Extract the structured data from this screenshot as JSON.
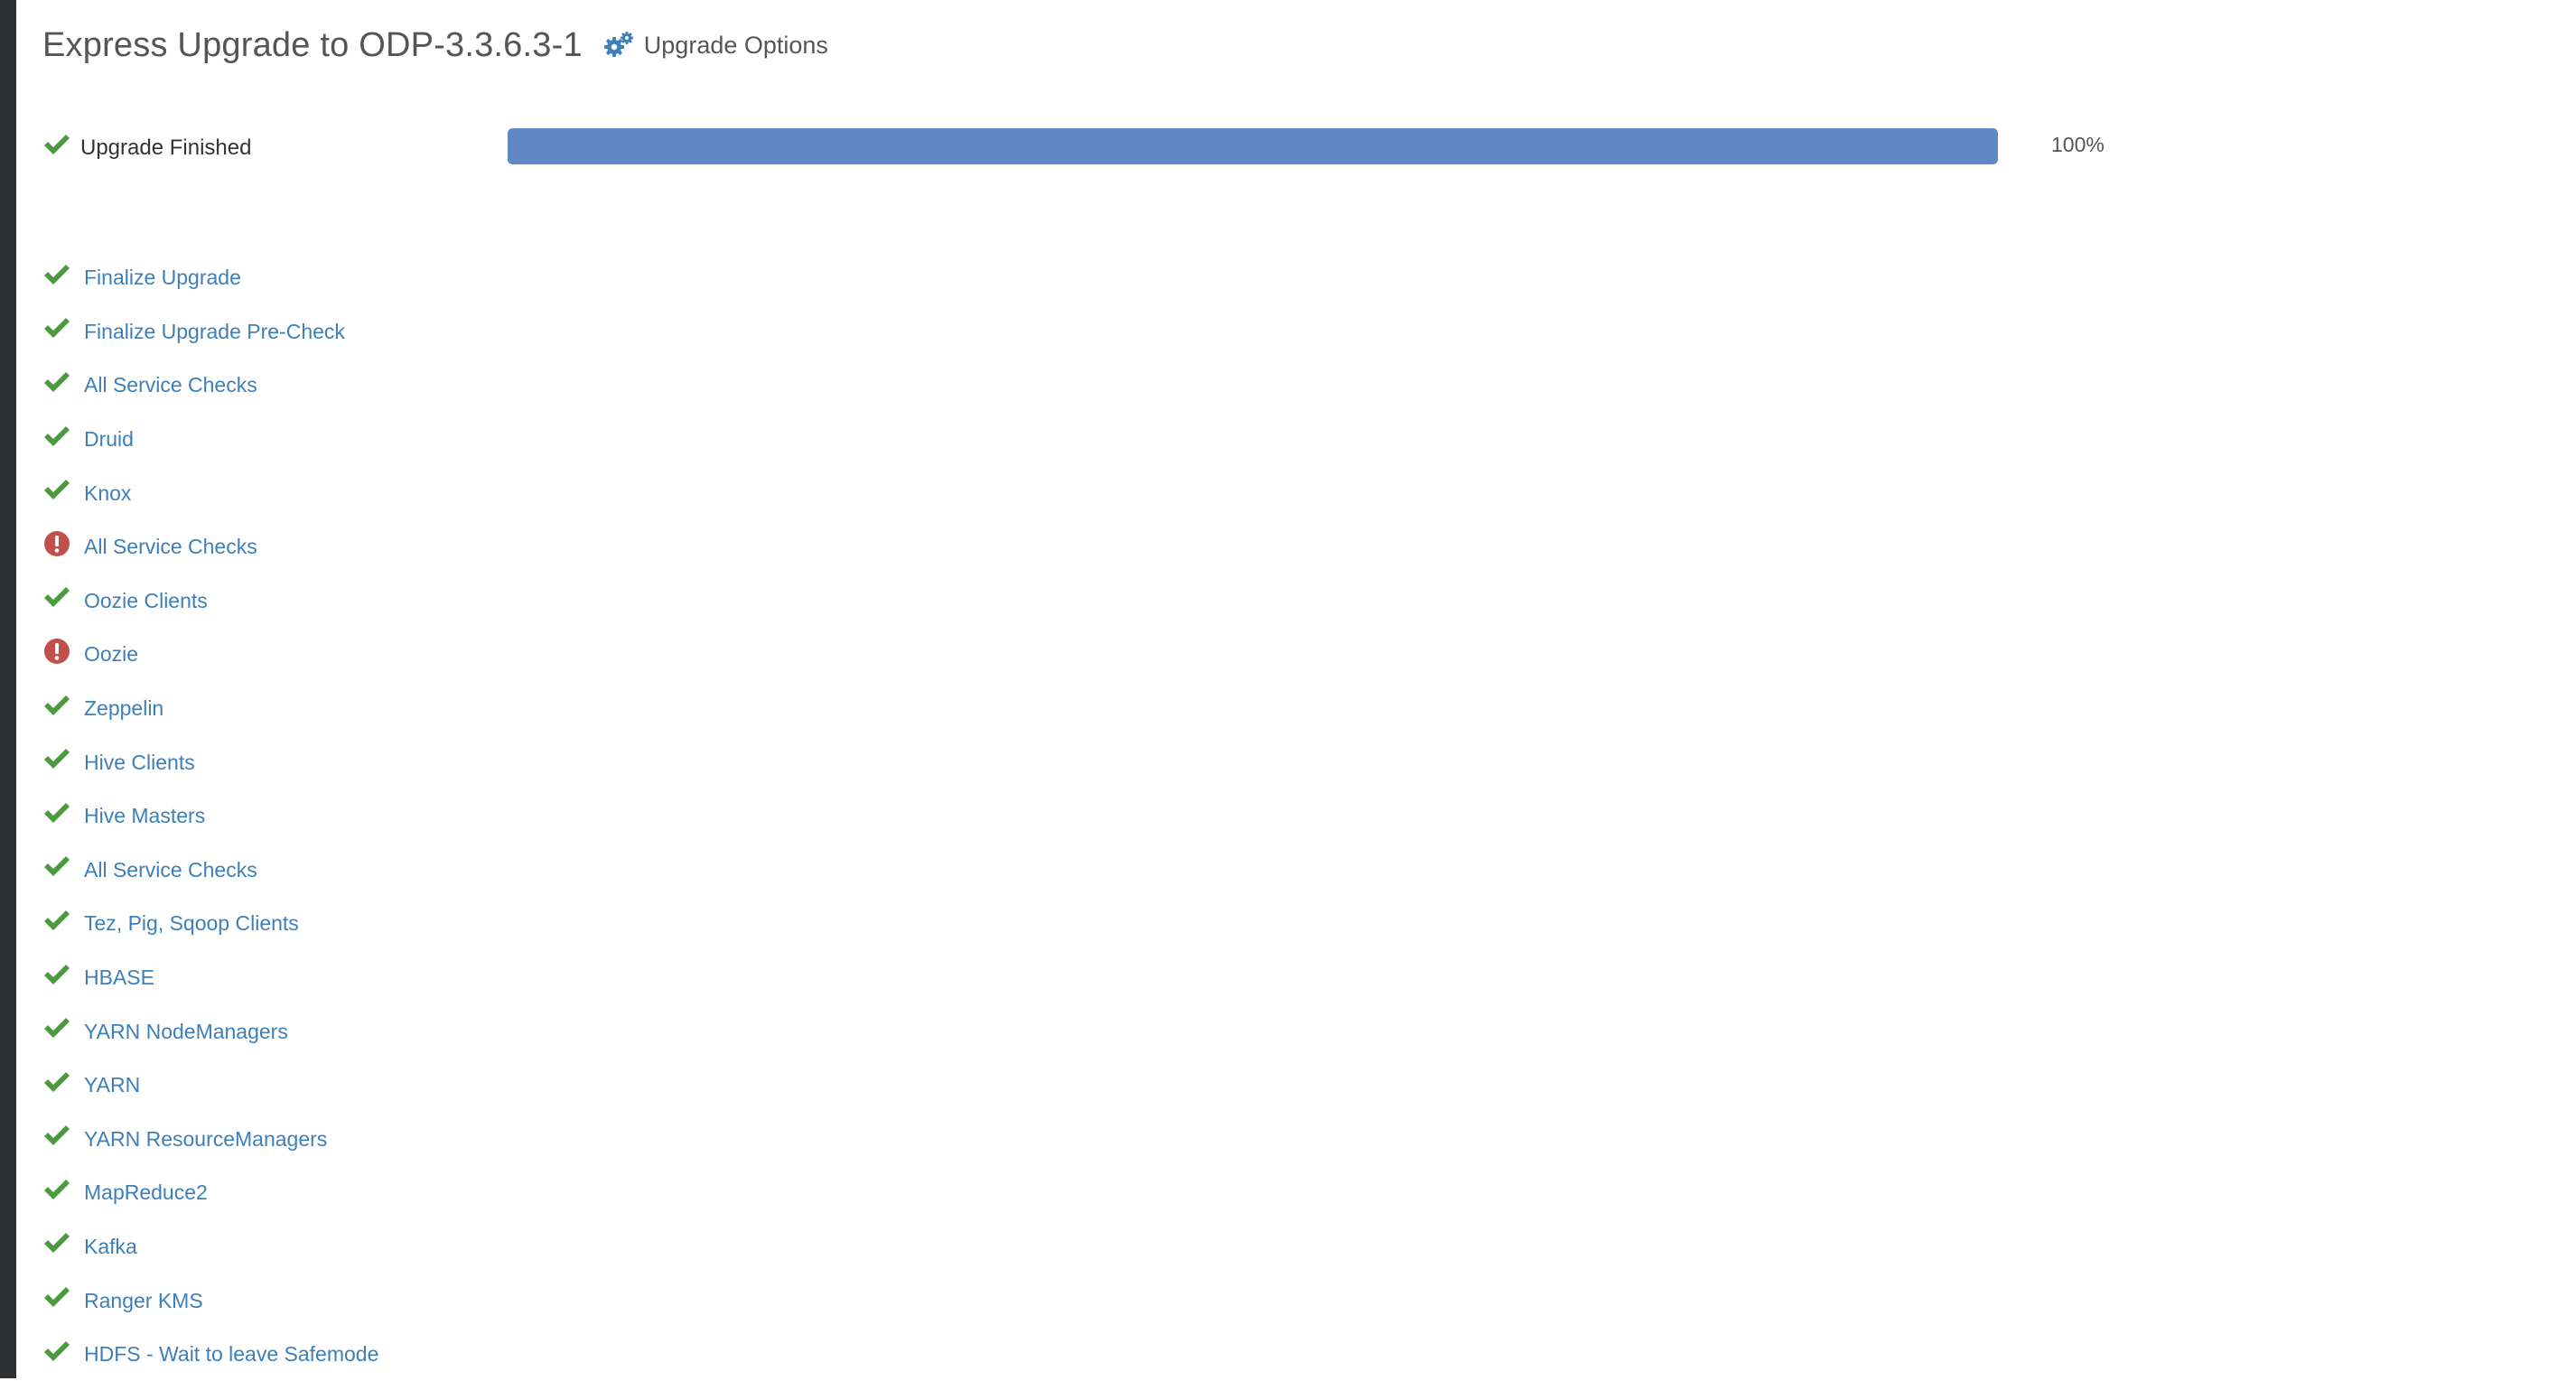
{
  "header": {
    "title": "Express Upgrade to ODP-3.3.6.3-1",
    "options_label": "Upgrade Options",
    "options_icon": "gears-icon"
  },
  "status": {
    "label": "Upgrade Finished",
    "icon": "check-icon",
    "progress_percent": 100,
    "progress_text": "100%"
  },
  "colors": {
    "success": "#4c9a3e",
    "error": "#c1504a",
    "link": "#3d7fb8",
    "progress": "#6088c4"
  },
  "steps": [
    {
      "label": "Finalize Upgrade",
      "status": "success"
    },
    {
      "label": "Finalize Upgrade Pre-Check",
      "status": "success"
    },
    {
      "label": "All Service Checks",
      "status": "success"
    },
    {
      "label": "Druid",
      "status": "success"
    },
    {
      "label": "Knox",
      "status": "success"
    },
    {
      "label": "All Service Checks",
      "status": "error"
    },
    {
      "label": "Oozie Clients",
      "status": "success"
    },
    {
      "label": "Oozie",
      "status": "error"
    },
    {
      "label": "Zeppelin",
      "status": "success"
    },
    {
      "label": "Hive Clients",
      "status": "success"
    },
    {
      "label": "Hive Masters",
      "status": "success"
    },
    {
      "label": "All Service Checks",
      "status": "success"
    },
    {
      "label": "Tez, Pig, Sqoop Clients",
      "status": "success"
    },
    {
      "label": "HBASE",
      "status": "success"
    },
    {
      "label": "YARN NodeManagers",
      "status": "success"
    },
    {
      "label": "YARN",
      "status": "success"
    },
    {
      "label": "YARN ResourceManagers",
      "status": "success"
    },
    {
      "label": "MapReduce2",
      "status": "success"
    },
    {
      "label": "Kafka",
      "status": "success"
    },
    {
      "label": "Ranger KMS",
      "status": "success"
    },
    {
      "label": "HDFS - Wait to leave Safemode",
      "status": "success"
    }
  ]
}
